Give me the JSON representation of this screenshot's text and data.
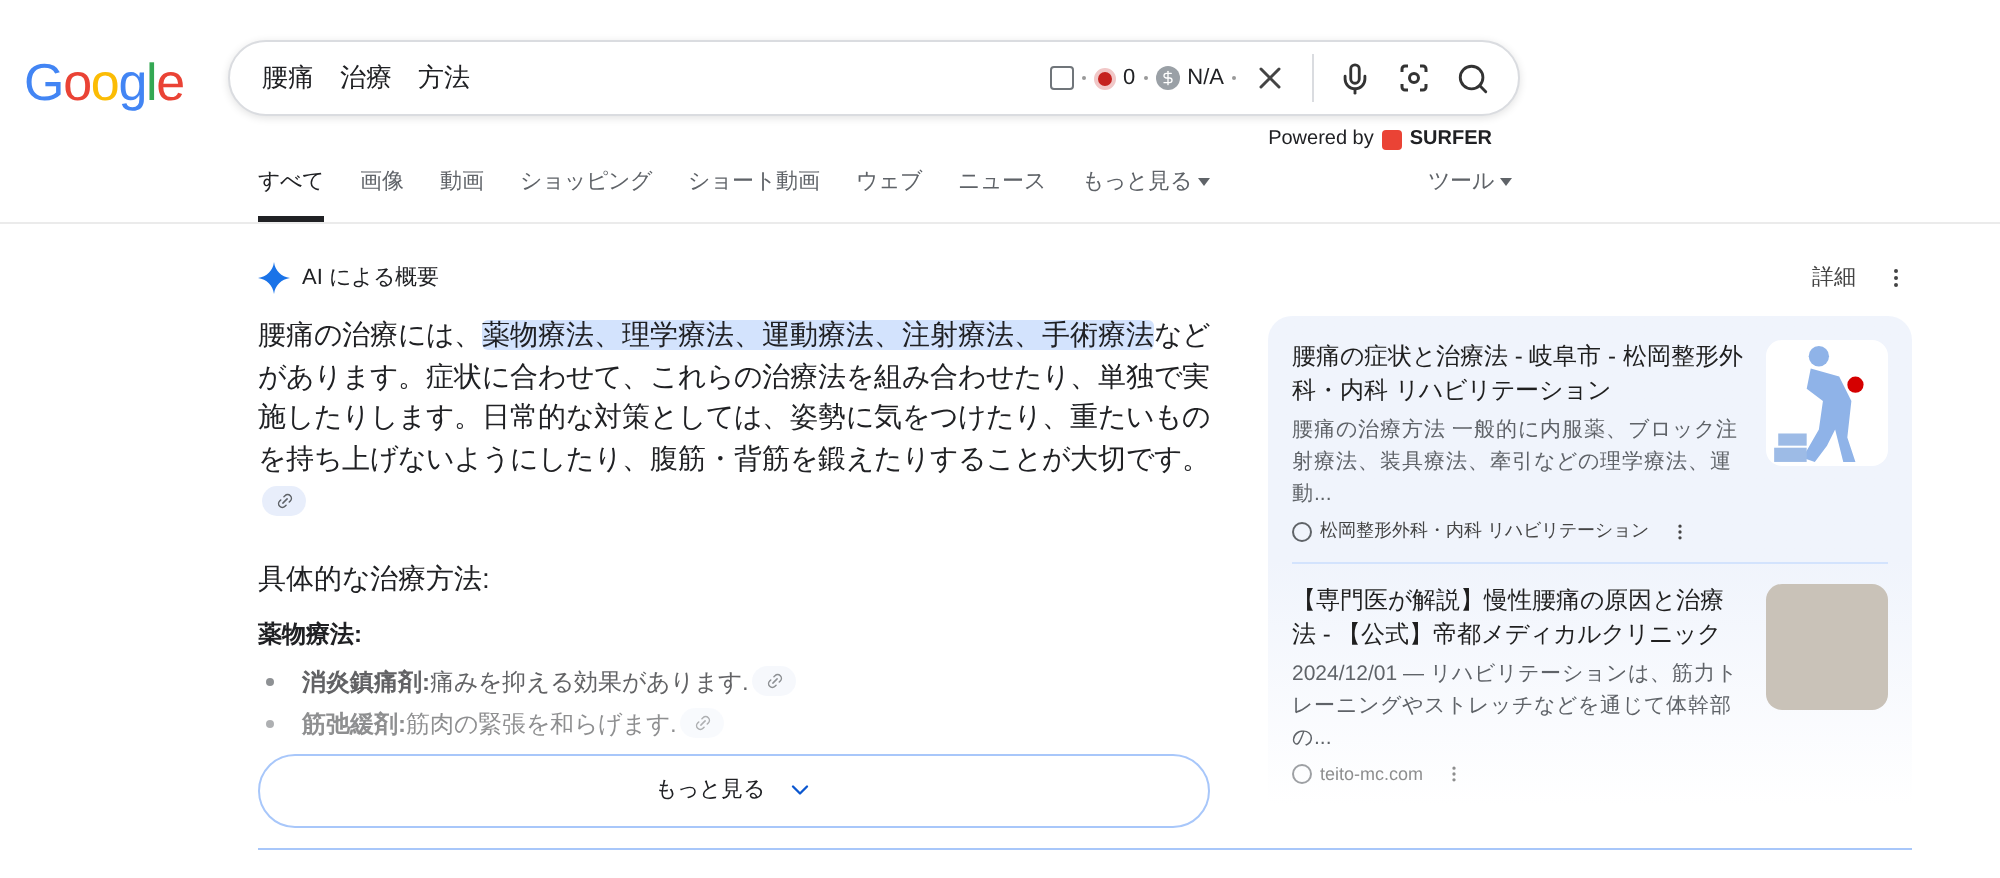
{
  "logo": "Google",
  "search": {
    "value": "腰痛　治療　方法",
    "extension": {
      "checked": false,
      "count": "0",
      "price": "N/A"
    },
    "powered_by": "Powered by",
    "brand": "SURFER"
  },
  "tabs": [
    {
      "label": "すべて",
      "selected": true,
      "caret": false
    },
    {
      "label": "画像",
      "selected": false,
      "caret": false
    },
    {
      "label": "動画",
      "selected": false,
      "caret": false
    },
    {
      "label": "ショッピング",
      "selected": false,
      "caret": false
    },
    {
      "label": "ショート動画",
      "selected": false,
      "caret": false
    },
    {
      "label": "ウェブ",
      "selected": false,
      "caret": false
    },
    {
      "label": "ニュース",
      "selected": false,
      "caret": false
    },
    {
      "label": "もっと見る",
      "selected": false,
      "caret": true
    }
  ],
  "tools": "ツール",
  "ai_overview": {
    "title": "AI による概要",
    "details": "詳細",
    "summary": [
      {
        "text": "腰痛の治療には、",
        "highlighted": false
      },
      {
        "text": "薬物療法、理学療法、運動療法、注射療法、手術療法",
        "highlighted": true
      },
      {
        "text": "などがあります。症状に合わせて、これらの治療法を組み合わせたり、単独で実施したりします。日常的な対策としては、姿勢に気をつけたり、重たいものを持ち上げないようにしたり、腹筋・背筋を鍛えたりすることが大切です。",
        "highlighted": false
      }
    ],
    "heading": "具体的な治療方法:",
    "subheading": "薬物療法:",
    "bullets": [
      {
        "term": "消炎鎮痛剤:",
        "text": "痛みを抑える効果があります."
      },
      {
        "term": "筋弛緩剤:",
        "text": "筋肉の緊張を和らげます."
      }
    ],
    "more_button": "もっと見る"
  },
  "sources": [
    {
      "title": "腰痛の症状と治療法 - 岐阜市 - 松岡整形外科・内科 リハビリテーション",
      "snippet": "腰痛の治療方法 一般的に内服薬、ブロック注射療法、装具療法、牽引などの理学療法、運動...",
      "site": "松岡整形外科・内科 リハビリテーション",
      "kind": "illustration"
    },
    {
      "title": "【専門医が解説】慢性腰痛の原因と治療法 - 【公式】帝都メディカルクリニック",
      "snippet": "2024/12/01 — リハビリテーションは、筋力トレーニングやストレッチなどを通じて体幹部の...",
      "site": "teito-mc.com",
      "kind": "photo"
    }
  ]
}
